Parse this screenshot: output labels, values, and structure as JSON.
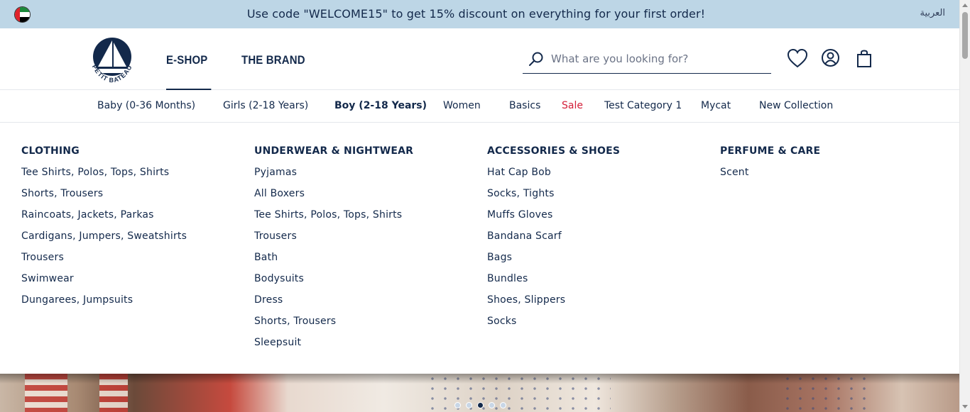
{
  "promo": {
    "text": "Use code \"WELCOME15\" to get 15% discount on everything for your first order!",
    "language_link": "العربية",
    "flag_icon": "uae-flag-icon"
  },
  "header": {
    "logo_text": "PETIT BATEAU",
    "nav": [
      "E-SHOP",
      "THE BRAND"
    ],
    "active_nav": "E-SHOP",
    "search_placeholder": "What are you looking for?",
    "icons": [
      "search-icon",
      "wishlist-heart-icon",
      "account-icon",
      "shopping-bag-icon"
    ]
  },
  "categories": [
    "Baby (0-36 Months)",
    "Girls (2-18 Years)",
    "Boy (2-18 Years)",
    "Women",
    "Basics",
    "Sale",
    "Test Category 1",
    "Mycat",
    "New Collection"
  ],
  "active_category": "Boy (2-18 Years)",
  "colors": {
    "promo_bg": "#bdd6e6",
    "navy": "#13294b",
    "sale": "#d4203a"
  },
  "mega_menu": [
    {
      "heading": "CLOTHING",
      "items": [
        "Tee Shirts, Polos, Tops, Shirts",
        "Shorts, Trousers",
        "Raincoats, Jackets, Parkas",
        "Cardigans, Jumpers, Sweatshirts",
        "Trousers",
        "Swimwear",
        "Dungarees, Jumpsuits"
      ]
    },
    {
      "heading": "UNDERWEAR & NIGHTWEAR",
      "items": [
        "Pyjamas",
        "All Boxers",
        "Tee Shirts, Polos, Tops, Shirts",
        "Trousers",
        "Bath",
        "Bodysuits",
        "Dress",
        "Shorts, Trousers",
        "Sleepsuit"
      ]
    },
    {
      "heading": "ACCESSORIES & SHOES",
      "items": [
        "Hat Cap Bob",
        "Socks, Tights",
        "Muffs Gloves",
        "Bandana Scarf",
        "Bags",
        "Bundles",
        "Shoes, Slippers",
        "Socks"
      ]
    },
    {
      "heading": "PERFUME & CARE",
      "items": [
        "Scent"
      ]
    }
  ],
  "carousel": {
    "slides": 5,
    "active_slide": 3
  }
}
